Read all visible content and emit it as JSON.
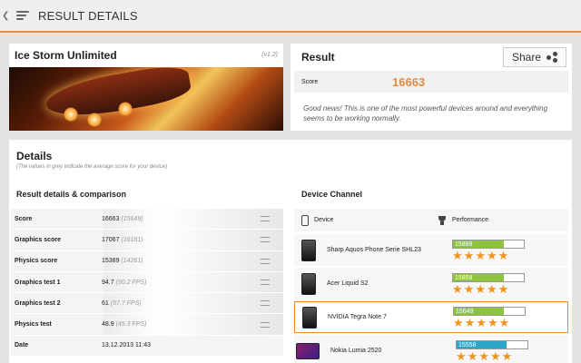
{
  "header": {
    "back_icon": "chevron-left-icon",
    "logo_icon": "3dmark-logo-icon",
    "title": "RESULT DETAILS"
  },
  "test": {
    "name": "Ice Storm Unlimited",
    "version": "(v1.2)"
  },
  "result": {
    "title": "Result",
    "share_label": "Share",
    "score_label": "Score",
    "score_value": "16663",
    "message": "Good news! This is one of the most powerful devices around and everything seems to be working normally."
  },
  "details": {
    "title": "Details",
    "subtitle": "(The values in grey indicate the average score for your device)",
    "comparison_title": "Result details & comparison",
    "rows": [
      {
        "label": "Score",
        "value": "16663",
        "avg": "(15649)"
      },
      {
        "label": "Graphics score",
        "value": "17067",
        "avg": "(16181)"
      },
      {
        "label": "Physics score",
        "value": "15389",
        "avg": "(14261)"
      },
      {
        "label": "Graphics test 1",
        "value": "94.7",
        "avg": "(90.2 FPS)"
      },
      {
        "label": "Graphics test 2",
        "value": "61",
        "avg": "(57.7 FPS)"
      },
      {
        "label": "Physics test",
        "value": "48.9",
        "avg": "(45.3 FPS)"
      },
      {
        "label": "Date",
        "value": "13.12.2013 11:43",
        "avg": ""
      }
    ]
  },
  "device_channel": {
    "title": "Device Channel",
    "col_device": "Device",
    "col_performance": "Performance",
    "devices": [
      {
        "name": "Sharp Aquos Phone Serie SHL23",
        "score": "15889",
        "fill": 0.72,
        "stars": 5
      },
      {
        "name": "Acer Liquid S2",
        "score": "15858",
        "fill": 0.72,
        "stars": 5
      },
      {
        "name": "NVIDIA Tegra Note 7",
        "score": "15649",
        "fill": 0.71,
        "stars": 5,
        "current": true
      },
      {
        "name": "Nokia Lumia 2520",
        "score": "15558",
        "fill": 0.7,
        "stars": 5
      }
    ]
  }
}
